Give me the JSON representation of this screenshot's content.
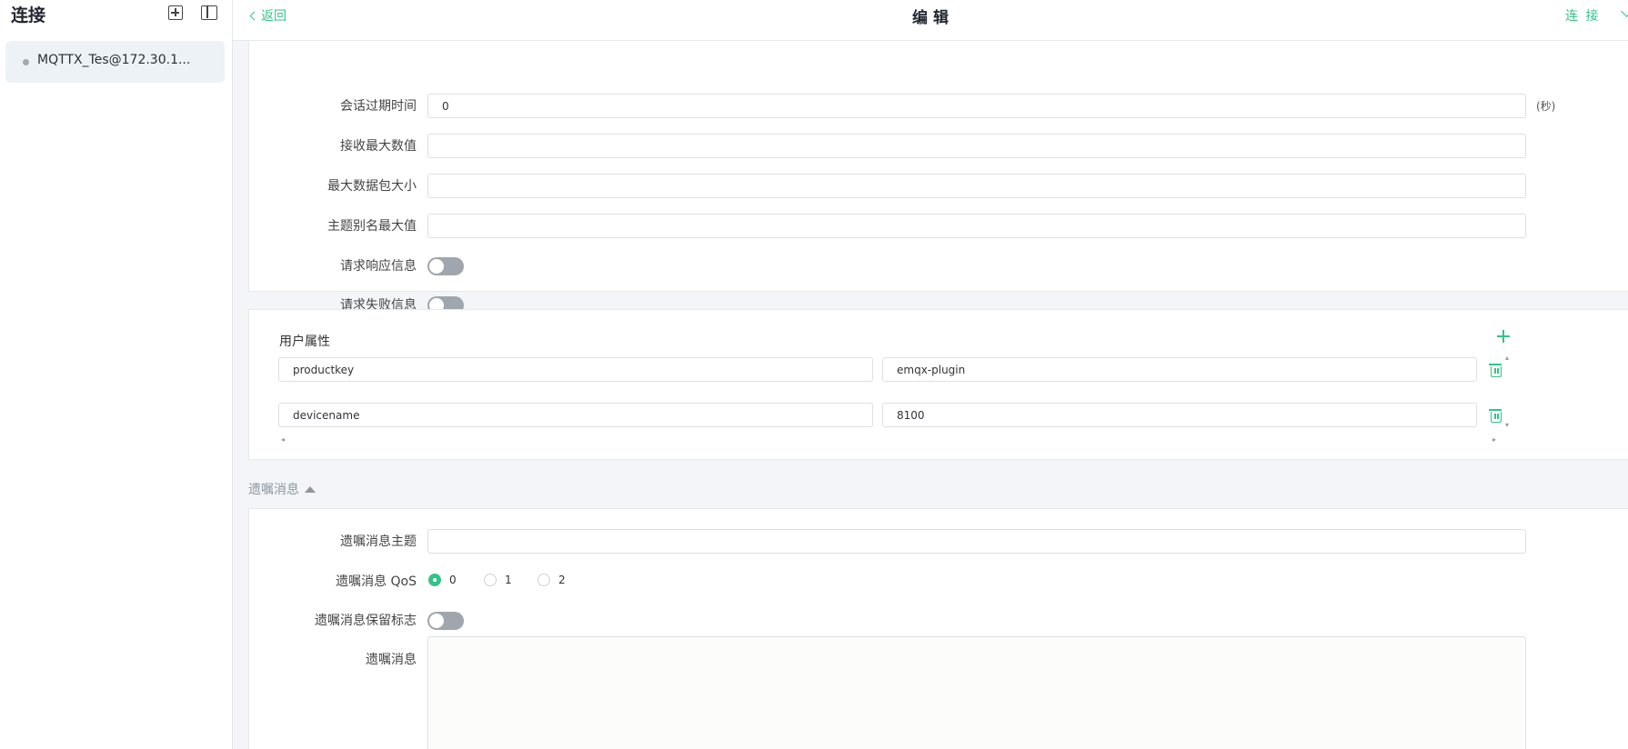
{
  "sidebar": {
    "title": "连接",
    "connections": [
      {
        "name": "MQTTX_Tes@172.30.1..."
      }
    ]
  },
  "topbar": {
    "back_label": "返回",
    "title": "编 辑",
    "connect_label": "连 接"
  },
  "advanced": {
    "session_expiry": {
      "label": "会话过期时间",
      "value": "0",
      "unit": "(秒)"
    },
    "receive_maximum": {
      "label": "接收最大数值",
      "value": ""
    },
    "max_packet_size": {
      "label": "最大数据包大小",
      "value": ""
    },
    "topic_alias_max": {
      "label": "主题别名最大值",
      "value": ""
    },
    "request_response_info": {
      "label": "请求响应信息",
      "enabled": false
    },
    "request_problem_info": {
      "label": "请求失败信息",
      "enabled": false
    }
  },
  "user_properties": {
    "title": "用户属性",
    "rows": [
      {
        "key": "productkey",
        "value": "emqx-plugin"
      },
      {
        "key": "devicename",
        "value": "8100"
      }
    ]
  },
  "will": {
    "section_title": "遗嘱消息",
    "topic": {
      "label": "遗嘱消息主题",
      "value": ""
    },
    "qos": {
      "label": "遗嘱消息 QoS",
      "options": [
        "0",
        "1",
        "2"
      ],
      "selected": "0"
    },
    "retain": {
      "label": "遗嘱消息保留标志",
      "enabled": false
    },
    "payload": {
      "label": "遗嘱消息",
      "value": ""
    }
  },
  "colors": {
    "accent": "#34c388",
    "toggle_off": "#a0a6ad"
  }
}
